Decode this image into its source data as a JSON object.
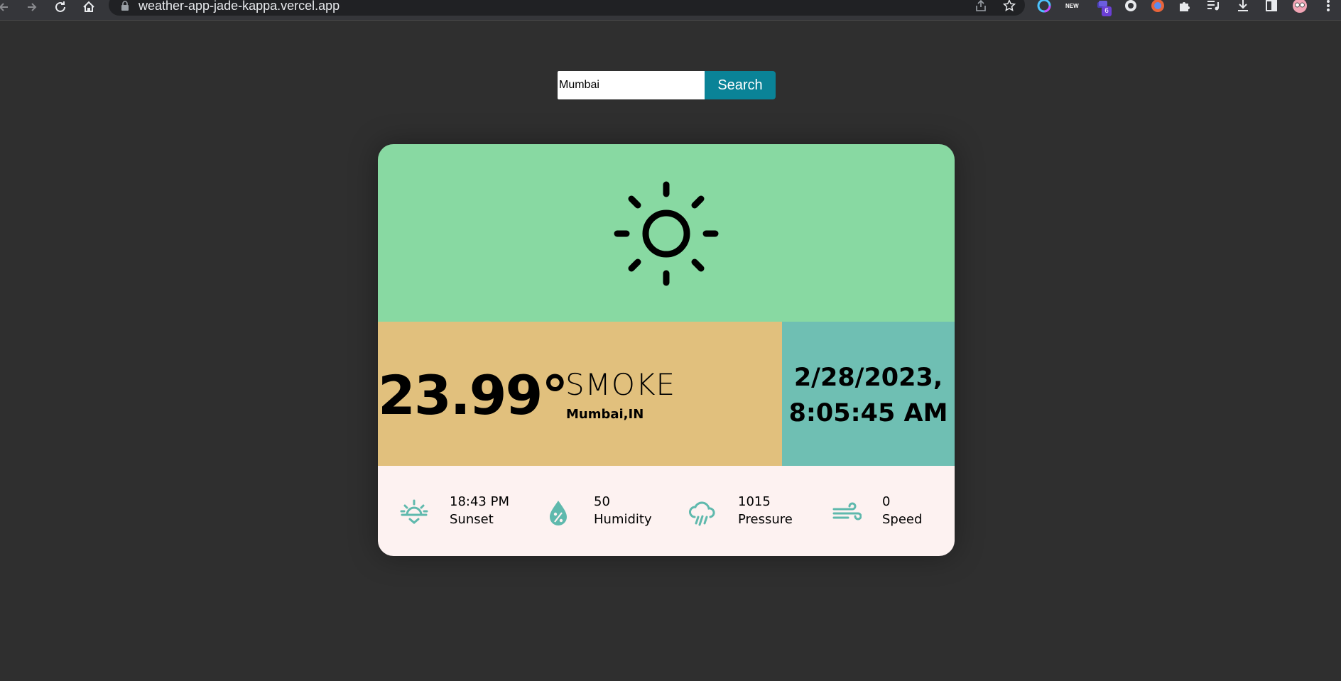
{
  "browser": {
    "url": "weather-app-jade-kappa.vercel.app",
    "extension_badge": "6",
    "extension_new_tag": "NEW"
  },
  "search": {
    "value": "Mumbai",
    "button_label": "Search"
  },
  "weather": {
    "icon": "sun-icon",
    "temperature": "23.99°",
    "condition": "SMOKE",
    "location": "Mumbai,IN",
    "date": "2/28/2023,",
    "time": "8:05:45 AM"
  },
  "stats": [
    {
      "icon": "sunset-icon",
      "value": "18:43 PM",
      "label": "Sunset"
    },
    {
      "icon": "humidity-icon",
      "value": "50",
      "label": "Humidity"
    },
    {
      "icon": "rain-cloud-icon",
      "value": "1015",
      "label": "Pressure"
    },
    {
      "icon": "wind-icon",
      "value": "0",
      "label": "Speed"
    }
  ],
  "colors": {
    "page_background": "#2f2f2f",
    "card_top": "#88d9a2",
    "card_mid_left": "#e1c07d",
    "card_mid_right": "#6fbfb3",
    "card_bottom": "#fdf2f1",
    "search_button": "#0a8397",
    "stat_icon": "#5fb9ad"
  }
}
